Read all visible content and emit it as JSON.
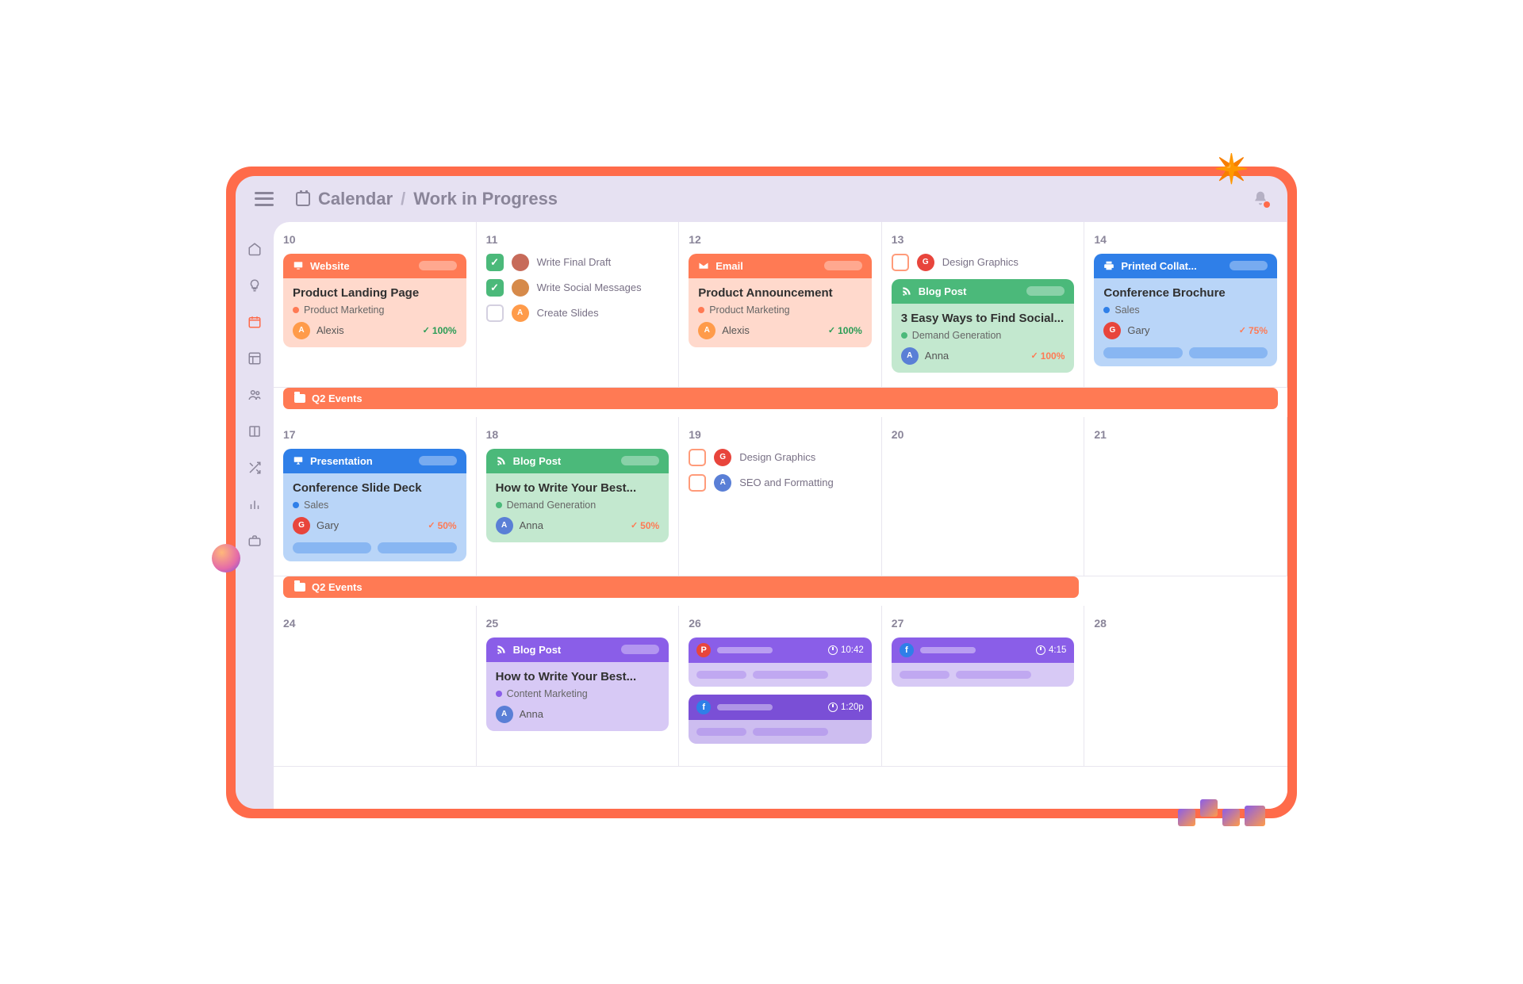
{
  "breadcrumb": {
    "root": "Calendar",
    "current": "Work in Progress"
  },
  "event_bar_label": "Q2 Events",
  "avatars": {
    "alexis": {
      "bg": "#ff9b4a",
      "initial": "A"
    },
    "anna": {
      "bg": "#5a7fd6",
      "initial": "A"
    },
    "gary": {
      "bg": "#e8453c",
      "initial": "G"
    },
    "unknown1": {
      "bg": "#c76b5a",
      "initial": ""
    },
    "unknown2": {
      "bg": "#d68a4a",
      "initial": ""
    }
  },
  "colors": {
    "orange_dot": "#ff7a54",
    "green_dot": "#4bb97a",
    "blue_dot": "#2f7fe8",
    "purple_dot": "#8a5ee8",
    "progress_orange": "#ff7a54",
    "progress_green": "#2a9c55"
  },
  "rows": [
    {
      "days": [
        {
          "date": "10",
          "card": {
            "theme": "orange",
            "icon": "monitor",
            "header": "Website",
            "title": "Product Landing Page",
            "tag": "Product Marketing",
            "tag_dot": "orange_dot",
            "assignee": "Alexis",
            "avatar": "alexis",
            "progress": "100%",
            "progress_color": "progress_green"
          }
        },
        {
          "date": "11",
          "tasks": [
            {
              "checked": true,
              "avatar": "unknown1",
              "text": "Write Final Draft"
            },
            {
              "checked": true,
              "avatar": "unknown2",
              "text": "Write Social Messages"
            },
            {
              "checked": false,
              "avatar": "alexis",
              "text": "Create Slides"
            }
          ]
        },
        {
          "date": "12",
          "card": {
            "theme": "orange",
            "icon": "mail",
            "header": "Email",
            "title": "Product Announcement",
            "tag": "Product Marketing",
            "tag_dot": "orange_dot",
            "assignee": "Alexis",
            "avatar": "alexis",
            "progress": "100%",
            "progress_color": "progress_green"
          }
        },
        {
          "date": "13",
          "tasks": [
            {
              "checked": false,
              "orange": true,
              "avatar": "gary",
              "text": "Design Graphics"
            }
          ],
          "card": {
            "theme": "green",
            "icon": "rss",
            "header": "Blog Post",
            "title": "3 Easy Ways to Find Social...",
            "tag": "Demand Generation",
            "tag_dot": "green_dot",
            "assignee": "Anna",
            "avatar": "anna",
            "progress": "100%",
            "progress_color": "progress_orange"
          }
        },
        {
          "date": "14",
          "card": {
            "theme": "blue",
            "icon": "print",
            "header": "Printed Collat...",
            "title": "Conference Brochure",
            "tag": "Sales",
            "tag_dot": "blue_dot",
            "assignee": "Gary",
            "avatar": "gary",
            "progress": "75%",
            "progress_color": "progress_orange",
            "skeleton": true
          }
        }
      ]
    },
    {
      "days": [
        {
          "date": "17",
          "card": {
            "theme": "blue",
            "icon": "present",
            "header": "Presentation",
            "title": "Conference Slide Deck",
            "tag": "Sales",
            "tag_dot": "blue_dot",
            "assignee": "Gary",
            "avatar": "gary",
            "progress": "50%",
            "progress_color": "progress_orange",
            "skeleton": true
          }
        },
        {
          "date": "18",
          "card": {
            "theme": "green",
            "icon": "rss",
            "header": "Blog Post",
            "title": "How to Write Your Best...",
            "tag": "Demand Generation",
            "tag_dot": "green_dot",
            "assignee": "Anna",
            "avatar": "anna",
            "progress": "50%",
            "progress_color": "progress_orange"
          }
        },
        {
          "date": "19",
          "tasks": [
            {
              "checked": false,
              "orange": true,
              "avatar": "gary",
              "text": "Design Graphics"
            },
            {
              "checked": false,
              "orange": true,
              "avatar": "anna",
              "text": "SEO and Formatting"
            }
          ]
        },
        {
          "date": "20"
        },
        {
          "date": "21"
        }
      ],
      "event_partial": true
    },
    {
      "days": [
        {
          "date": "24"
        },
        {
          "date": "25",
          "card": {
            "theme": "purple",
            "icon": "rss",
            "header": "Blog Post",
            "title": "How to Write Your Best...",
            "tag": "Content Marketing",
            "tag_dot": "purple_dot",
            "assignee": "Anna",
            "avatar": "anna"
          }
        },
        {
          "date": "26",
          "social": [
            {
              "net": "pinterest",
              "net_bg": "#e8453c",
              "glyph": "P",
              "head_bg": "#8a5ee8",
              "body_bg": "#d7c9f5",
              "time": "10:42"
            },
            {
              "net": "facebook",
              "net_bg": "#2f7fe8",
              "glyph": "f",
              "head_bg": "#7a4fd6",
              "body_bg": "#cdbdf0",
              "time": "1:20p"
            }
          ]
        },
        {
          "date": "27",
          "social": [
            {
              "net": "facebook",
              "net_bg": "#2f7fe8",
              "glyph": "f",
              "head_bg": "#8a5ee8",
              "body_bg": "#d7c9f5",
              "time": "4:15"
            }
          ]
        },
        {
          "date": "28"
        }
      ]
    }
  ]
}
